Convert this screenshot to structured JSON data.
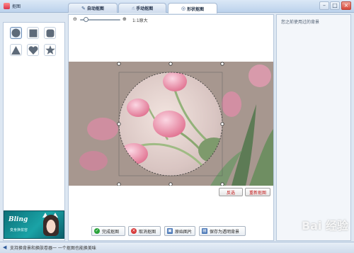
{
  "window": {
    "title": "抠图"
  },
  "tabs": [
    {
      "label": "自动抠图",
      "icon": "pen-icon"
    },
    {
      "label": "手动抠图",
      "icon": "hand-icon"
    },
    {
      "label": "形状抠图",
      "icon": "shape-icon",
      "active": true
    }
  ],
  "window_buttons": {
    "minimize": "–",
    "maximize": "□",
    "close": "×"
  },
  "shapes": [
    {
      "name": "circle",
      "selected": true
    },
    {
      "name": "square"
    },
    {
      "name": "rounded-square"
    },
    {
      "name": "triangle"
    },
    {
      "name": "heart"
    },
    {
      "name": "star"
    }
  ],
  "zoom": {
    "label": "1:1原大",
    "level_fraction": 0.1
  },
  "canvas": {
    "image_subject": "pink tulips"
  },
  "actions": {
    "invert": "反选",
    "redo": "重新抠图"
  },
  "bottom_buttons": [
    {
      "label": "完成抠图",
      "icon": "check-icon",
      "color": "#2aa33a"
    },
    {
      "label": "取消抠图",
      "icon": "cancel-icon",
      "color": "#d83a3a"
    },
    {
      "label": "原始图片",
      "icon": "image-icon",
      "color": "#4a78b8"
    },
    {
      "label": "保存为透明背景",
      "icon": "save-icon",
      "color": "#4a78b8"
    }
  ],
  "right_panel": {
    "label": "您之前使用过的背景"
  },
  "promo": {
    "title": "Bling",
    "subtitle": "变身换妆容"
  },
  "status": {
    "text": "支持换背景和换肤卷器一 一个抠图也能换美味"
  },
  "watermark": "Bai 经验"
}
